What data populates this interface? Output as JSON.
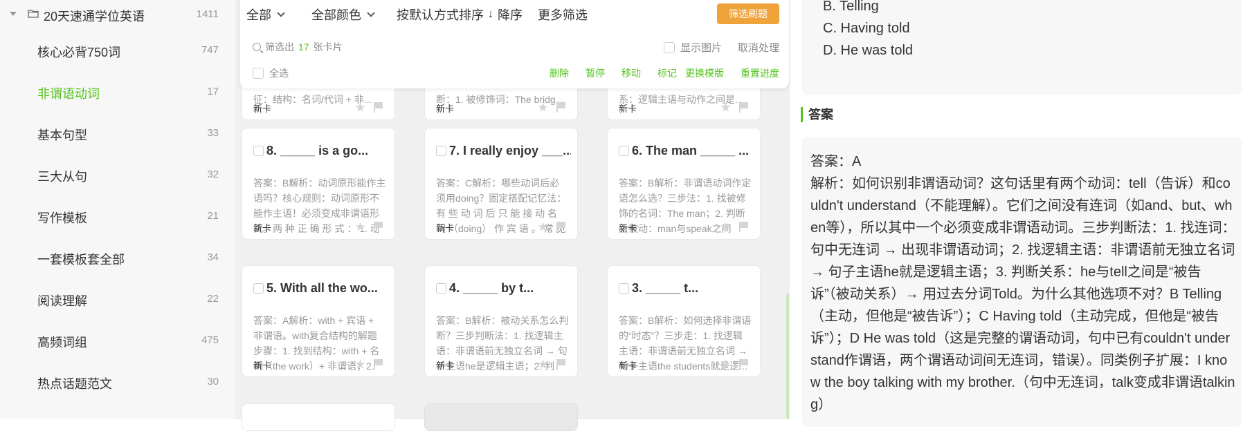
{
  "sidebar": {
    "root": {
      "name": "20天速通学位英语",
      "count": "1411"
    },
    "items": [
      {
        "name": "核心必背750词",
        "count": "747",
        "active": false
      },
      {
        "name": "非谓语动词",
        "count": "17",
        "active": true
      },
      {
        "name": "基本句型",
        "count": "33",
        "active": false
      },
      {
        "name": "三大从句",
        "count": "32",
        "active": false
      },
      {
        "name": "写作模板",
        "count": "21",
        "active": false
      },
      {
        "name": "一套模板套全部",
        "count": "34",
        "active": false
      },
      {
        "name": "阅读理解",
        "count": "22",
        "active": false
      },
      {
        "name": "高频词组",
        "count": "475",
        "active": false
      },
      {
        "name": "热点话题范文",
        "count": "30",
        "active": false
      }
    ]
  },
  "toolbar": {
    "filter_all": "全部",
    "filter_color": "全部颜色",
    "sort": "按默认方式排序",
    "sort_dir": "降序",
    "more_filter": "更多筛选",
    "refresh": "筛选刷题",
    "summary_prefix": "筛选出",
    "summary_count": "17",
    "summary_suffix": "张卡片",
    "show_images": "显示图片",
    "cancel_processing": "取消处理",
    "select_all": "全选",
    "actions": {
      "delete": "删除",
      "pause": "暂停",
      "move": "移动",
      "mark": "标记",
      "change_template": "更换模版",
      "reset_progress": "重置进度"
    }
  },
  "cards_partial": [
    {
      "body": "征：结构：名词/代词 + 非...",
      "tag": "新卡"
    },
    {
      "body": "断：1. 被修饰词：The bridge...",
      "tag": "新卡"
    },
    {
      "body": "系：逻辑主语与动作之间是...",
      "tag": "新卡"
    }
  ],
  "cards": [
    {
      "title": "8.  _____  is  a  go...",
      "body": "答案：B解析：动词原形能作主语吗？核心规则：动词原形不能作主语！必须变成非谓语形式。两 种 正 确 形 式 ： 1. 动 名 ...",
      "tag": "新卡"
    },
    {
      "title": "7. I really enjoy ___...",
      "body": "答案：C解析：哪些动词后必须用doing？固定搭配记忆法：有 些 动 词 后 只 能 接 动 名 词 （doing） 作 宾 语 。 常 见 ...",
      "tag": "新卡"
    },
    {
      "title": "6.  The  man  _____  ...",
      "body": "答案：B解析：非谓语动词作定语怎么选？三步法：1. 找被修饰的名词：The man；2. 判断主被动：man与speak之间是“人...",
      "tag": "新卡"
    },
    {
      "title": "5.  With  all  the  wo...",
      "body": "答案：A解析：with + 宾语 + 非谓语。with复合结构的解题步骤：1. 找到结构：with + 名词（the work）+ 非谓语；2. 判...",
      "tag": "新卡"
    },
    {
      "title": "4.    _____    by    t...",
      "body": "答案：B解析：被动关系怎么判断？三步判断法：1. 找逻辑主语：非谓语前无独立名词 → 句子主语he是逻辑主语；2. 判断...",
      "tag": "新卡"
    },
    {
      "title": "3.         _____         t...",
      "body": "答案：B解析：如何选择非谓语的“时态”？三步走：1. 找逻辑主语：非谓语前无独立名词 → 句子主语the students就是逻...",
      "tag": "新卡"
    }
  ],
  "detail": {
    "options": [
      "B. Telling",
      "C. Having told",
      "D. He was told"
    ],
    "answer_heading": "答案",
    "answer_text": "答案：A\n解析：如何识别非谓语动词？这句话里有两个动词：tell（告诉）和couldn't understand（不能理解）。它们之间没有连词（如and、but、when等），所以其中一个必须变成非谓语动词。三步判断法：1. 找连词：句中无连词 → 出现非谓语动词；2. 找逻辑主语：非谓语前无独立名词 → 句子主语he就是逻辑主语；3. 判断关系：he与tell之间是“被告诉”（被动关系）→ 用过去分词Told。为什么其他选项不对？B Telling（主动，但他是“被告诉”）；C Having told（主动完成，但他是“被告诉”）；D He was told（这是完整的谓语动词，句中已有couldn't understand作谓语，两个谓语动词间无连词，错误）。同类例子扩展：I know the boy talking with my brother.（句中无连词，talk变成非谓语talking）"
  }
}
